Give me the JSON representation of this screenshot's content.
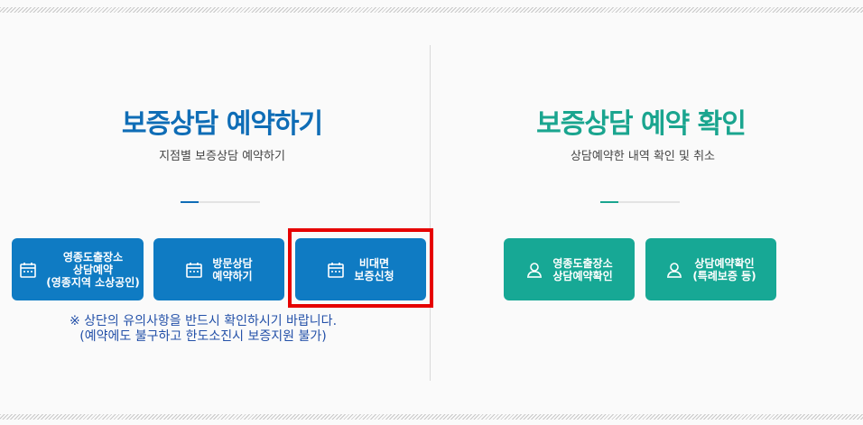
{
  "reserve": {
    "title": "보증상담 예약하기",
    "subtitle": "지점별 보증상담 예약하기",
    "buttons": [
      {
        "label": "영종도출장소\n상담예약\n(영종지역 소상공인)",
        "icon": "calendar-icon"
      },
      {
        "label": "방문상담\n예약하기",
        "icon": "calendar-icon"
      },
      {
        "label": "비대면\n보증신청",
        "icon": "calendar-icon"
      }
    ],
    "notice": "※ 상단의 유의사항을 반드시 확인하시기 바랍니다.\n(예약에도 불구하고 한도소진시 보증지원 불가)"
  },
  "confirm": {
    "title": "보증상담 예약 확인",
    "subtitle": "상담예약한 내역 확인 및 취소",
    "buttons": [
      {
        "label": "영종도출장소\n상담예약확인",
        "icon": "user-icon"
      },
      {
        "label": "상담예약확인\n(특례보증 등)",
        "icon": "user-icon"
      }
    ]
  },
  "colors": {
    "blue": "#0f7bc3",
    "green": "#17a895",
    "highlight": "#e60000"
  }
}
